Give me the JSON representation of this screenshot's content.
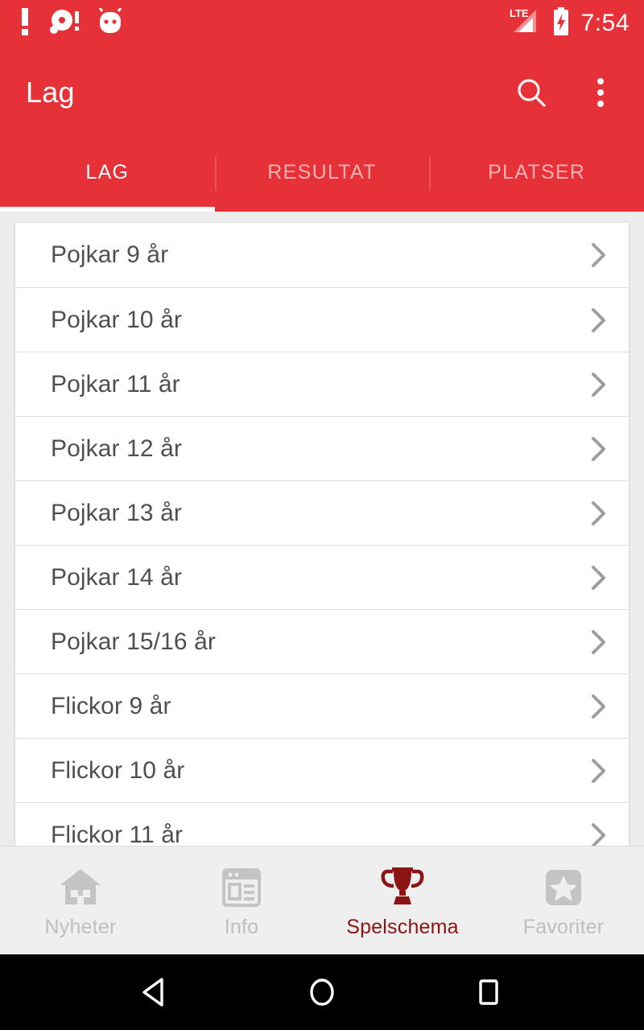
{
  "statusbar": {
    "icons": [
      "exclamation-alert-icon",
      "disc-alert-icon",
      "android-head-icon"
    ],
    "network_label": "LTE",
    "signal_icon": "signal-bars-icon",
    "battery_icon": "battery-charging-icon",
    "time": "7:54"
  },
  "toolbar": {
    "title": "Lag",
    "search_icon": "search-icon",
    "overflow_icon": "more-vert-icon"
  },
  "tabs": {
    "items": [
      {
        "label": "LAG",
        "active": true
      },
      {
        "label": "RESULTAT",
        "active": false
      },
      {
        "label": "PLATSER",
        "active": false
      }
    ]
  },
  "list": {
    "chevron_icon": "chevron-right-icon",
    "items": [
      {
        "label": "Pojkar 9 år"
      },
      {
        "label": "Pojkar 10 år"
      },
      {
        "label": "Pojkar 11 år"
      },
      {
        "label": "Pojkar 12 år"
      },
      {
        "label": "Pojkar 13 år"
      },
      {
        "label": "Pojkar 14 år"
      },
      {
        "label": "Pojkar 15/16 år"
      },
      {
        "label": "Flickor 9 år"
      },
      {
        "label": "Flickor 10 år"
      },
      {
        "label": "Flickor 11 år"
      }
    ]
  },
  "bottomnav": {
    "items": [
      {
        "label": "Nyheter",
        "icon": "home-icon",
        "active": false
      },
      {
        "label": "Info",
        "icon": "article-icon",
        "active": false
      },
      {
        "label": "Spelschema",
        "icon": "trophy-icon",
        "active": true
      },
      {
        "label": "Favoriter",
        "icon": "star-icon",
        "active": false
      }
    ]
  },
  "sysnav": {
    "back_icon": "back-triangle-icon",
    "home_icon": "home-circle-icon",
    "recents_icon": "recents-square-icon"
  },
  "colors": {
    "primary_red": "#E73138",
    "active_nav": "#8B1414",
    "page_bg": "#ECECEC",
    "inactive_nav": "#BFBFBF",
    "list_text": "#4F4F4F"
  }
}
